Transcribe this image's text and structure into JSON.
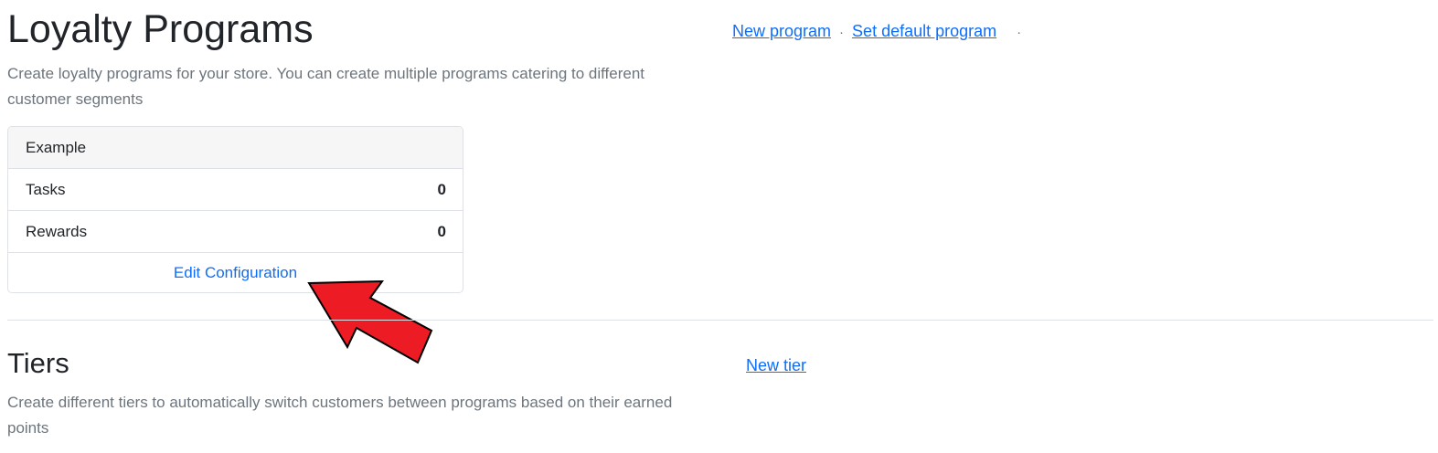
{
  "header": {
    "title": "Loyalty Programs",
    "description": "Create loyalty programs for your store. You can create multiple programs catering to different customer segments",
    "actions": {
      "new_program": "New program",
      "set_default": "Set default program",
      "separator": "·"
    }
  },
  "program_card": {
    "name": "Example",
    "rows": [
      {
        "label": "Tasks",
        "value": "0"
      },
      {
        "label": "Rewards",
        "value": "0"
      }
    ],
    "edit_link": "Edit Configuration"
  },
  "tiers": {
    "title": "Tiers",
    "description": "Create different tiers to automatically switch customers between programs based on their earned points",
    "new_tier": "New tier"
  },
  "annotation": {
    "arrow_color": "#ed1c24"
  },
  "colors": {
    "link": "#0d6efd",
    "muted_text": "#6c757d",
    "border": "#dee2e6",
    "card_header_bg": "#f6f6f6"
  }
}
